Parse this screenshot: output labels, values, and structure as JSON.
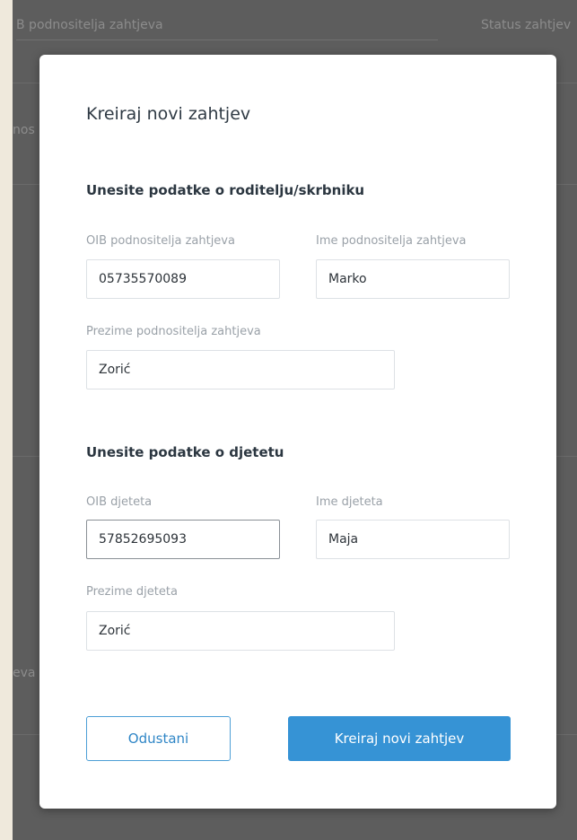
{
  "background": {
    "header_left": "B podnositelja zahtjeva",
    "header_right": "Status zahtjev",
    "row_fragment_1": "nos",
    "row_fragment_2": "eva"
  },
  "modal": {
    "title": "Kreiraj novi zahtjev",
    "parent_section": {
      "title": "Unesite podatke o roditelju/skrbniku",
      "oib": {
        "label": "OIB podnositelja zahtjeva",
        "value": "05735570089"
      },
      "first_name": {
        "label": "Ime podnositelja zahtjeva",
        "value": "Marko"
      },
      "last_name": {
        "label": "Prezime podnositelja zahtjeva",
        "value": "Zorić"
      }
    },
    "child_section": {
      "title": "Unesite podatke o djetetu",
      "oib": {
        "label": "OIB djeteta",
        "value": "57852695093"
      },
      "first_name": {
        "label": "Ime djeteta",
        "value": "Maja"
      },
      "last_name": {
        "label": "Prezime djeteta",
        "value": "Zorić"
      }
    },
    "buttons": {
      "cancel": "Odustani",
      "submit": "Kreiraj novi zahtjev"
    }
  },
  "colors": {
    "primary": "#3693d5",
    "overlay": "#5d5d5d",
    "outer_background": "#efe9dc"
  }
}
